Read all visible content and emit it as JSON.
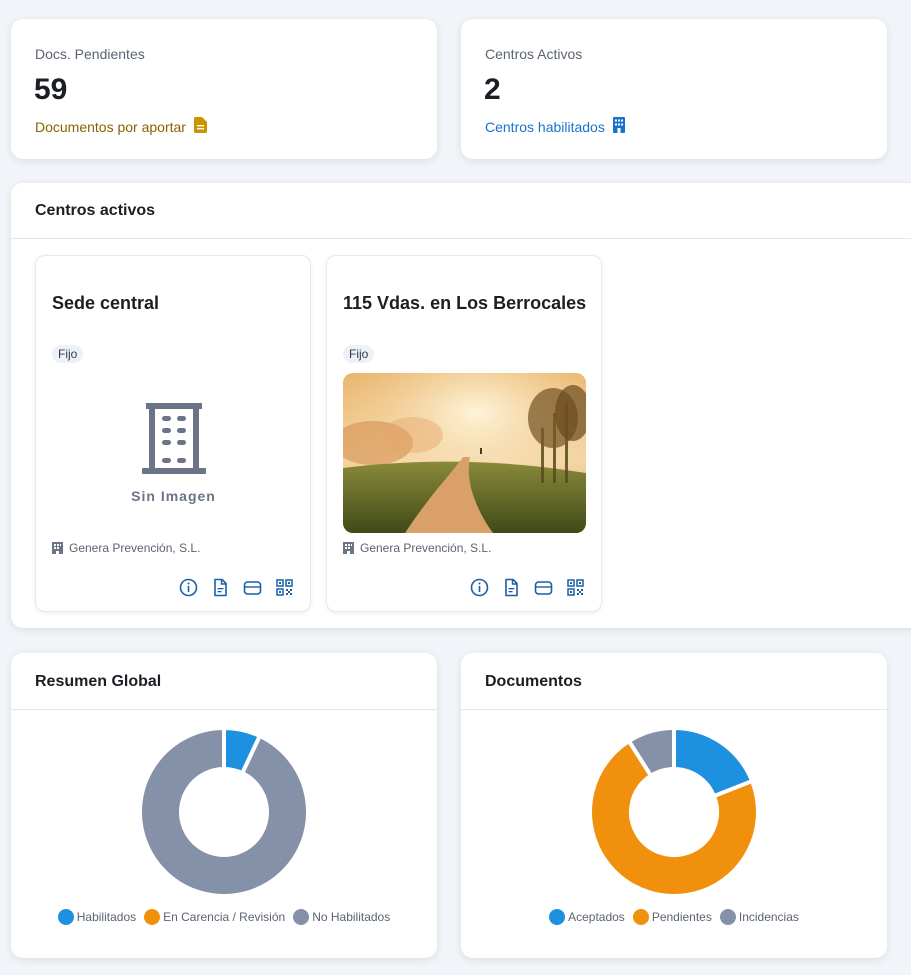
{
  "stats": {
    "pending": {
      "label": "Docs. Pendientes",
      "value": "59",
      "sub": "Documentos por aportar",
      "icon": "document-icon",
      "color": "#b88a00"
    },
    "active": {
      "label": "Centros Activos",
      "value": "2",
      "sub": "Centros habilitados",
      "icon": "building-icon",
      "color": "#1a73c9"
    }
  },
  "centros": {
    "title": "Centros activos",
    "items": [
      {
        "name": "Sede central",
        "tag": "Fijo",
        "image": "Sin Imagen",
        "company": "Genera Prevención, S.L."
      },
      {
        "name": "115 Vdas. en Los Berrocales",
        "tag": "Fijo",
        "company": "Genera Prevención, S.L."
      }
    ],
    "action_icons": [
      "info-icon",
      "document-icon",
      "folder-icon",
      "qr-code-icon"
    ]
  },
  "resumen": {
    "title": "Resumen Global",
    "chart_data": {
      "type": "pie",
      "categories": [
        "Habilitados",
        "En Carencia / Revisión",
        "No Habilitados"
      ],
      "values": [
        7,
        0,
        93
      ],
      "colors": [
        "#1e90e0",
        "#f0900c",
        "#8591a8"
      ]
    }
  },
  "documentos": {
    "title": "Documentos",
    "chart_data": {
      "type": "pie",
      "categories": [
        "Aceptados",
        "Pendientes",
        "Incidencias"
      ],
      "values": [
        19,
        72,
        9
      ],
      "colors": [
        "#1e90e0",
        "#f0900c",
        "#8591a8"
      ]
    }
  }
}
